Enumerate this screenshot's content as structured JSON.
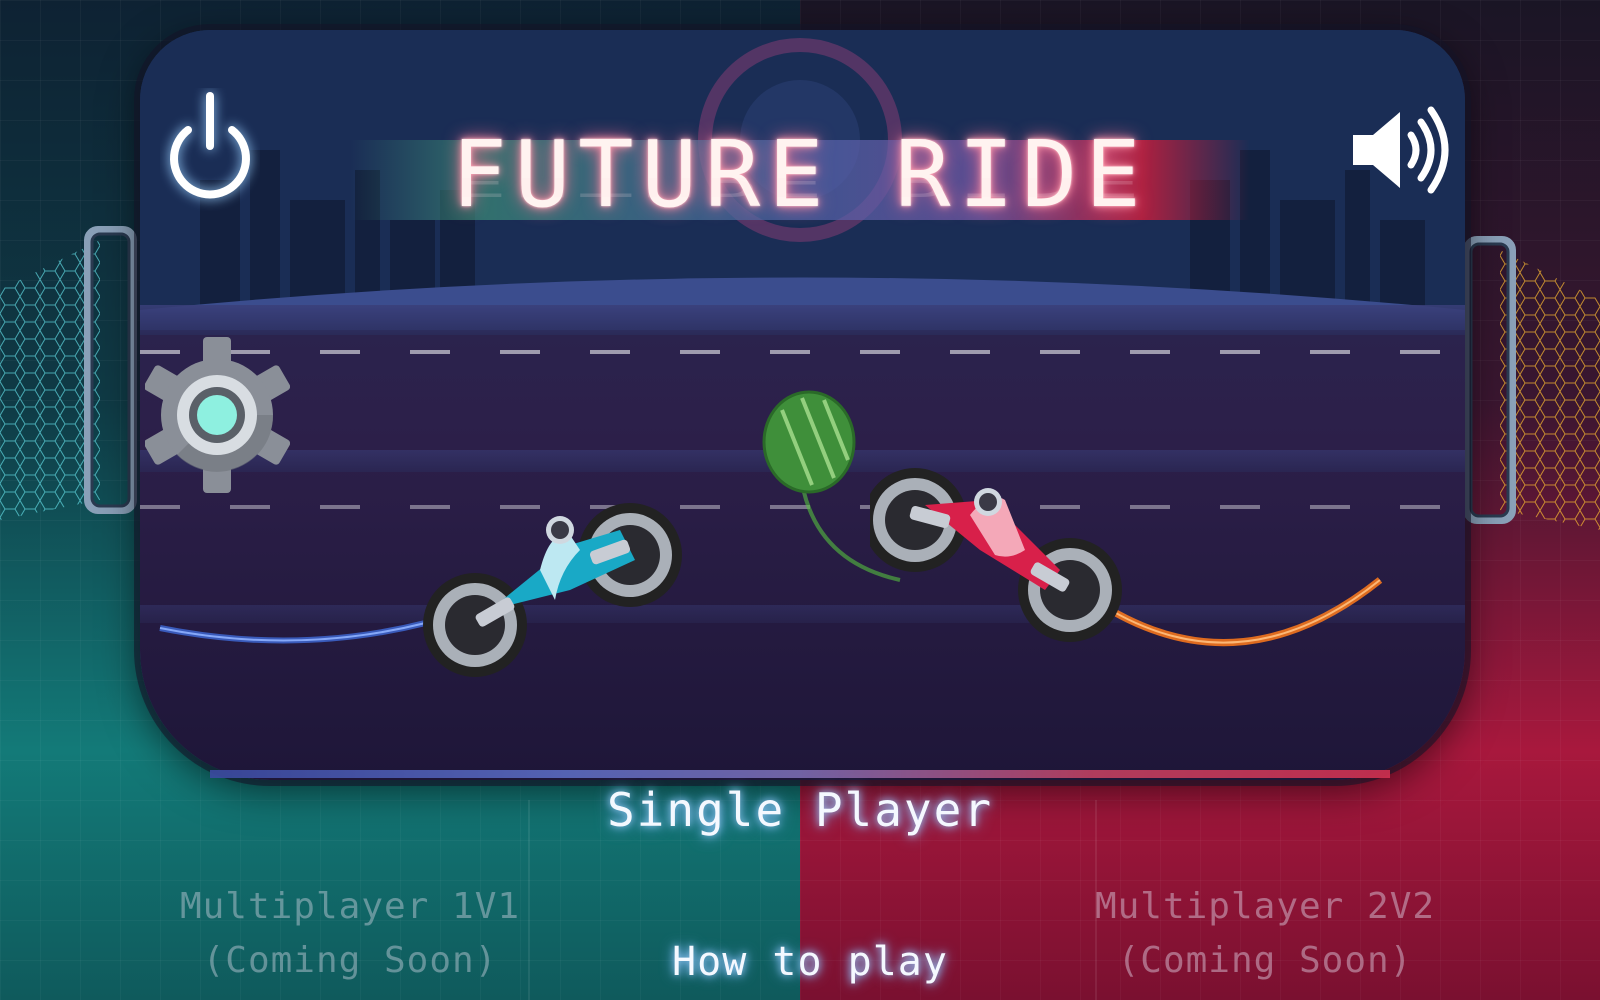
{
  "game": {
    "title": "FUTURE RIDE",
    "colors": {
      "team_left": "#18a6b8",
      "team_right": "#e0304f",
      "ball": "#4fa84a",
      "title_glow": "#ff6f90"
    }
  },
  "toolbar": {
    "power_icon": "power-icon",
    "sound_icon": "speaker-icon",
    "settings_icon": "gear-icon"
  },
  "menu": {
    "single_player": "Single Player",
    "how_to_play": "How to play",
    "multiplayer_1v1": {
      "line1": "Multiplayer 1V1",
      "line2": "(Coming Soon)"
    },
    "multiplayer_2v2": {
      "line1": "Multiplayer 2V2",
      "line2": "(Coming Soon)"
    }
  }
}
